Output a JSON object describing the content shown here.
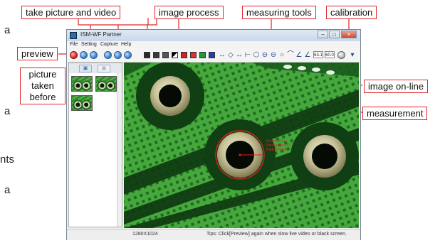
{
  "annotations": {
    "take_picture_video": "take picture and video",
    "image_process": "image process",
    "measuring_tools": "measuring tools",
    "calibration": "calibration",
    "preview": "preview",
    "picture_taken_before": [
      "picture",
      "taken",
      "before"
    ],
    "image_online": "image on-line",
    "measurement": "measurement"
  },
  "side_text": {
    "right": [
      "a",
      "a",
      "a"
    ],
    "left": "nts"
  },
  "window": {
    "title": "ISM-WF Partner",
    "menu": [
      "File",
      "Setting",
      "Capture",
      "Help"
    ],
    "toolbar": {
      "field_a": "63.1",
      "field_b": "60.0"
    },
    "measurement_lines": [
      "Area=XXXX",
      "Perimeter=XXX",
      "Radius=XXX"
    ],
    "status_resolution": "1280X1024",
    "status_tip": "Tips: Click[Preview] again when slow live video or black screen."
  },
  "colors": {
    "callout_border": "#e0252b",
    "pcb_green": "#3c9a36",
    "measure_red": "#e02020"
  }
}
